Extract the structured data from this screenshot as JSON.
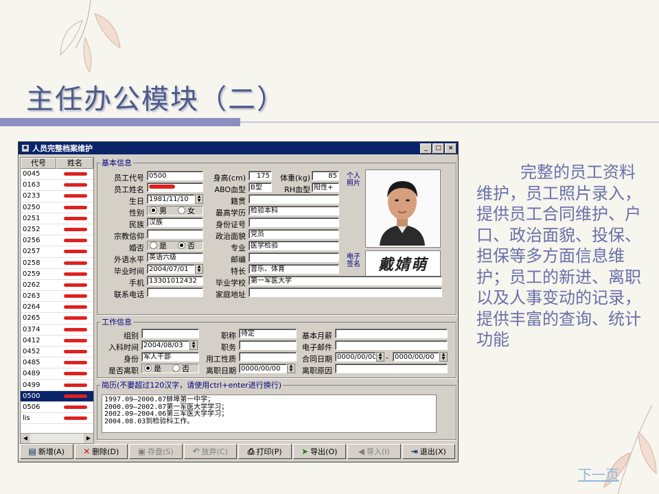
{
  "slide": {
    "title": "主任办公模块（二）",
    "description": "完整的员工资料维护，员工照片录入，提供员工合同维护、户口、政治面貌、投保、担保等多方面信息维护；员工的新进、离职以及人事变动的记录，提供丰富的查询、统计功能",
    "next_link": "下一页"
  },
  "window": {
    "title": "人员完整档案维护",
    "controls": [
      "_",
      "□",
      "×"
    ]
  },
  "list": {
    "headers": [
      "代号",
      "姓名"
    ],
    "rows": [
      {
        "code": "0045"
      },
      {
        "code": "0163"
      },
      {
        "code": "0233"
      },
      {
        "code": "0250"
      },
      {
        "code": "0251"
      },
      {
        "code": "0252"
      },
      {
        "code": "0256"
      },
      {
        "code": "0257"
      },
      {
        "code": "0258"
      },
      {
        "code": "0259"
      },
      {
        "code": "0262"
      },
      {
        "code": "0263"
      },
      {
        "code": "0264"
      },
      {
        "code": "0265"
      },
      {
        "code": "0374"
      },
      {
        "code": "0412"
      },
      {
        "code": "0452"
      },
      {
        "code": "0485"
      },
      {
        "code": "0489"
      },
      {
        "code": "0499"
      },
      {
        "code": "0500"
      },
      {
        "code": "0506"
      },
      {
        "code": "lis"
      }
    ],
    "selected": "0500"
  },
  "basic": {
    "legend": "基本信息",
    "emp_code_label": "员工代号",
    "emp_code": "0500",
    "emp_name_label": "员工姓名",
    "birth_label": "生日",
    "birth": "1981/11/10",
    "gender_label": "性别",
    "gender_male": "男",
    "gender_female": "女",
    "ethnic_label": "民族",
    "ethnic": "汉族",
    "religion_label": "宗教信仰",
    "married_label": "婚否",
    "yes": "是",
    "no": "否",
    "lang_label": "外语水平",
    "lang": "英语六级",
    "grad_time_label": "毕业时间",
    "grad_time": "2004/07/01",
    "mobile_label": "手机",
    "mobile": "13301012432",
    "phone_label": "联系电话",
    "height_label": "身高(cm)",
    "height": "175",
    "weight_label": "体重(kg)",
    "weight": "85",
    "abo_label": "ABO血型",
    "abo": "B型",
    "rh_label": "RH血型",
    "rh": "阳性+",
    "native_label": "籍贯",
    "edu_label": "最高学历",
    "edu": "检验本科",
    "id_label": "身份证号",
    "political_label": "政治面貌",
    "political": "党员",
    "major_label": "专业",
    "major": "医学检验",
    "postcode_label": "邮编",
    "speciality_label": "特长",
    "speciality": "音乐、体育",
    "school_label": "毕业学校",
    "school": "第一军医大学",
    "address_label": "家庭地址",
    "photo_label": "个人照片",
    "sign_label": "电子签名",
    "signature_text": "戴婧萌"
  },
  "work": {
    "legend": "工作信息",
    "group_label": "组别",
    "join_label": "入科时间",
    "join": "2004/08/03",
    "identity_label": "身份",
    "identity": "军人干部",
    "resigned_label": "是否离职",
    "yes": "是",
    "no": "否",
    "title_label": "职称",
    "title": "待定",
    "duty_label": "职务",
    "emp_type_label": "用工性质",
    "leave_date_label": "离职日期",
    "leave_date": "0000/00/00",
    "salary_label": "基本月薪",
    "email_label": "电子邮件",
    "contract_label": "合同日期",
    "contract_from": "0000/00/00",
    "contract_to": "0000/00/00",
    "contract_sep": "-",
    "leave_reason_label": "离职原因"
  },
  "resume": {
    "legend": "简历(不要超过120汉字，请使用ctrl+enter进行换行)",
    "lines": [
      "1997.09—2000.07蚌埠第一中学；",
      "2000.09—2002.07第一军医大学学习；",
      "2002.09—2004.06第三军医大学学习；",
      "2004.08.03到检验科工作。"
    ]
  },
  "buttons": [
    {
      "label": "新增(A)",
      "icon": "new-icon",
      "enabled": true
    },
    {
      "label": "删除(D)",
      "icon": "delete-icon",
      "enabled": true
    },
    {
      "label": "存盘(S)",
      "icon": "save-icon",
      "enabled": false
    },
    {
      "label": "放弃(C)",
      "icon": "cancel-icon",
      "enabled": false
    },
    {
      "label": "打印(P)",
      "icon": "print-icon",
      "enabled": true
    },
    {
      "label": "导出(O)",
      "icon": "export-icon",
      "enabled": true
    },
    {
      "label": "导入(I)",
      "icon": "import-icon",
      "enabled": false
    },
    {
      "label": "退出(X)",
      "icon": "exit-icon",
      "enabled": true
    }
  ]
}
